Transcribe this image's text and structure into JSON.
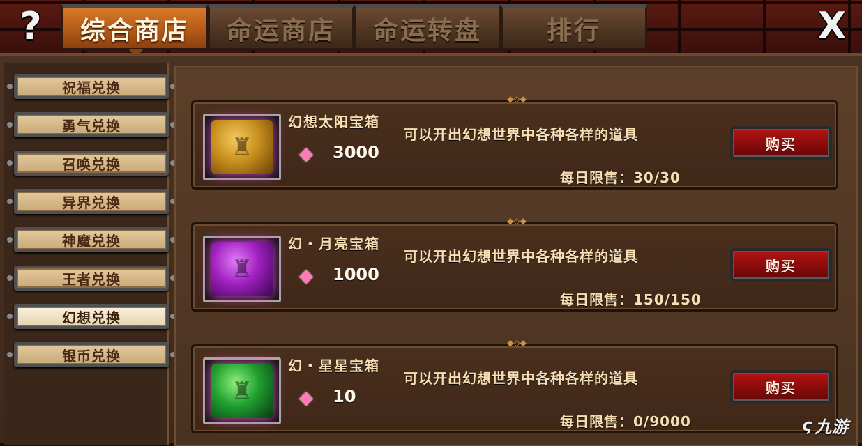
{
  "header": {
    "help_glyph": "?",
    "close_glyph": "X",
    "tabs": [
      {
        "label": "综合商店",
        "active": true
      },
      {
        "label": "命运商店",
        "active": false
      },
      {
        "label": "命运转盘",
        "active": false
      },
      {
        "label": "排行",
        "active": false
      }
    ]
  },
  "sidebar": {
    "items": [
      {
        "label": "祝福兑换",
        "active": false
      },
      {
        "label": "勇气兑换",
        "active": false
      },
      {
        "label": "召唤兑换",
        "active": false
      },
      {
        "label": "异界兑换",
        "active": false
      },
      {
        "label": "神魔兑换",
        "active": false
      },
      {
        "label": "王者兑换",
        "active": false
      },
      {
        "label": "幻想兑换",
        "active": true
      },
      {
        "label": "银币兑换",
        "active": false
      }
    ]
  },
  "shop": {
    "items": [
      {
        "name": "幻想太阳宝箱",
        "price": "3000",
        "description": "可以开出幻想世界中各种各样的道具",
        "limit": "每日限售：30/30",
        "buy_label": "购买",
        "color": "#c8901c"
      },
      {
        "name": "幻・月亮宝箱",
        "price": "1000",
        "description": "可以开出幻想世界中各种各样的道具",
        "limit": "每日限售：150/150",
        "buy_label": "购买",
        "color": "#a020c0"
      },
      {
        "name": "幻・星星宝箱",
        "price": "10",
        "description": "可以开出幻想世界中各种各样的道具",
        "limit": "每日限售：0/9000",
        "buy_label": "购买",
        "color": "#20a030"
      }
    ]
  },
  "watermark": {
    "text": "九游",
    "icon": "swirl-logo"
  }
}
